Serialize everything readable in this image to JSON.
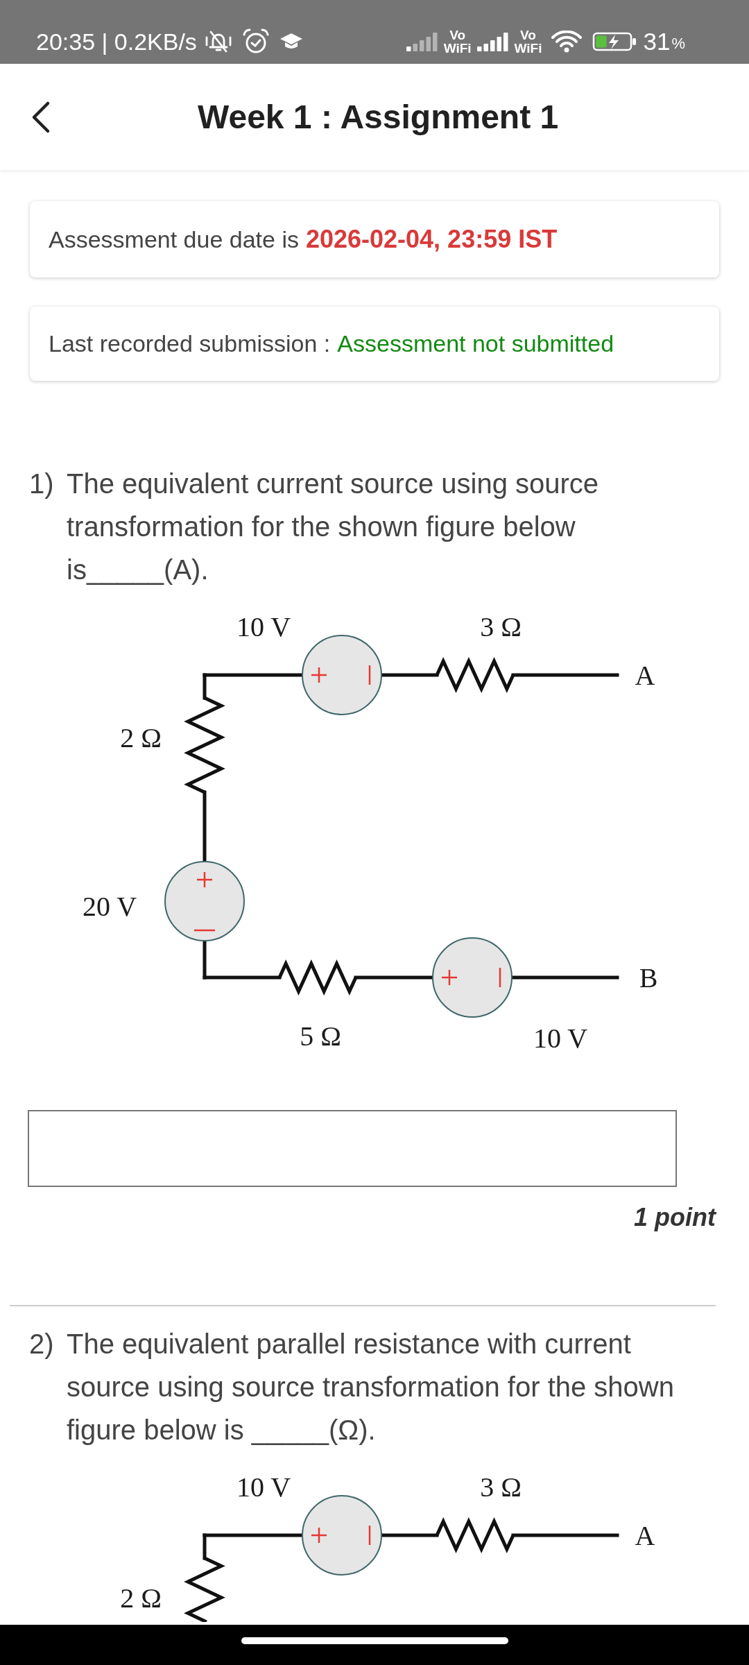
{
  "status_bar": {
    "time_and_speed": "20:35 | 0.2KB/s",
    "vowifi_labels": [
      "Vo WiFi",
      "Vo WiFi"
    ],
    "battery_percent": "31",
    "percent_sign": "%"
  },
  "header": {
    "title": "Week 1 : Assignment 1"
  },
  "due_card": {
    "label": "Assessment due date is",
    "value": "2026-02-04, 23:59 IST"
  },
  "submission_card": {
    "label": "Last recorded submission :",
    "value": "Assessment not submitted"
  },
  "questions": [
    {
      "number": "1)",
      "text": "The equivalent current source using source transformation for the shown figure below is_____(A).",
      "figure": {
        "parts": [
          {
            "kind": "source",
            "label": "10 V"
          },
          {
            "kind": "resistor",
            "label": "3 Ω"
          },
          {
            "kind": "terminal",
            "label": "A"
          },
          {
            "kind": "resistor",
            "label": "2 Ω"
          },
          {
            "kind": "source",
            "label": "20 V"
          },
          {
            "kind": "terminal",
            "label": "B"
          },
          {
            "kind": "resistor",
            "label": "5 Ω"
          },
          {
            "kind": "source",
            "label": "10 V"
          }
        ]
      },
      "answer_field": {
        "kind": "text"
      },
      "points": "1 point"
    },
    {
      "number": "2)",
      "text": "The equivalent parallel resistance with current source using source transformation for the shown figure below is _____(Ω).",
      "figure": {
        "parts": [
          {
            "kind": "source",
            "label": "10 V"
          },
          {
            "kind": "resistor",
            "label": "3 Ω"
          },
          {
            "kind": "terminal",
            "label": "A"
          },
          {
            "kind": "resistor",
            "label": "2 Ω"
          }
        ]
      }
    }
  ]
}
